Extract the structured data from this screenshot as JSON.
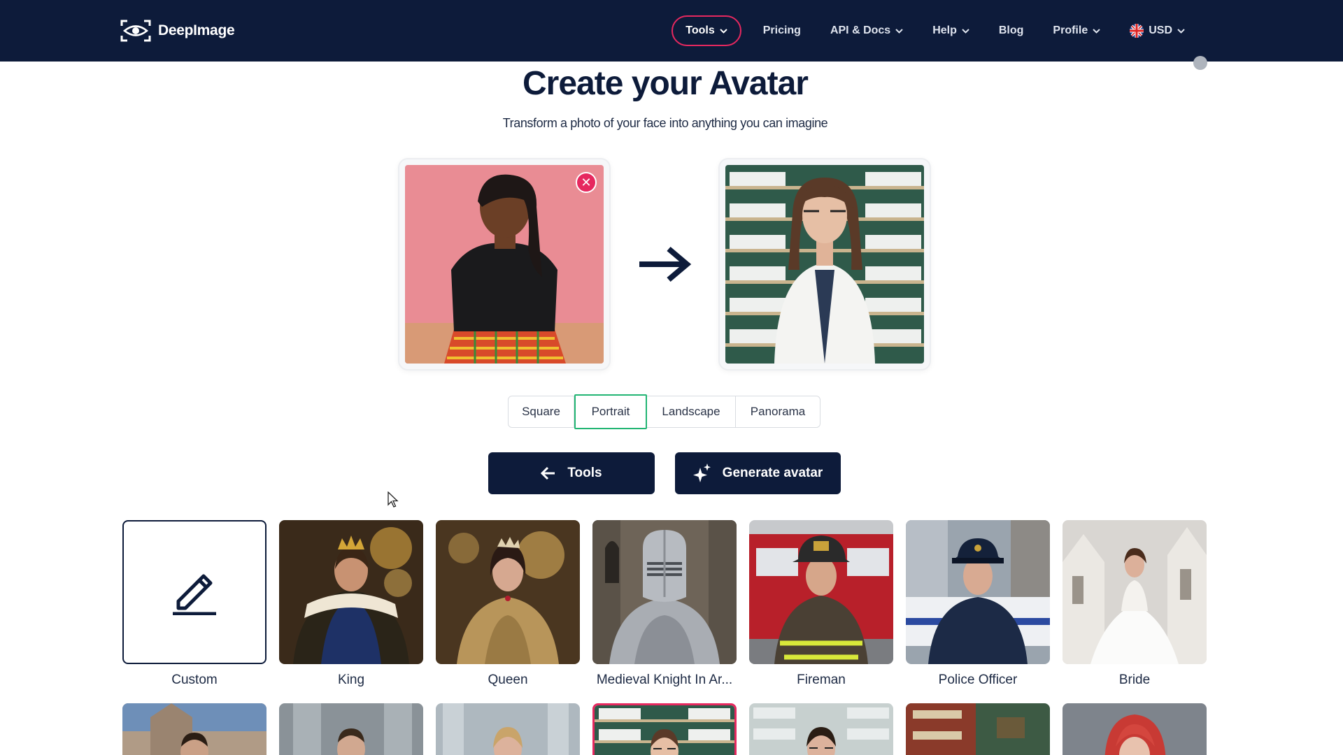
{
  "header": {
    "logo_text": "DeepImage",
    "nav": [
      {
        "label": "Tools",
        "has_dropdown": true,
        "active": true
      },
      {
        "label": "Pricing",
        "has_dropdown": false
      },
      {
        "label": "API & Docs",
        "has_dropdown": true
      },
      {
        "label": "Help",
        "has_dropdown": true
      },
      {
        "label": "Blog",
        "has_dropdown": false
      },
      {
        "label": "Profile",
        "has_dropdown": true
      },
      {
        "label": "USD",
        "has_dropdown": true,
        "icon": "uk-flag-icon"
      }
    ]
  },
  "hero": {
    "title": "Create your Avatar",
    "subtitle": "Transform a photo of your face into anything you can imagine"
  },
  "aspect": {
    "options": [
      "Square",
      "Portrait",
      "Landscape",
      "Panorama"
    ],
    "selected": "Portrait"
  },
  "actions": {
    "back_label": "Tools",
    "generate_label": "Generate avatar"
  },
  "styles": {
    "row1": [
      {
        "label": "Custom"
      },
      {
        "label": "King"
      },
      {
        "label": "Queen"
      },
      {
        "label": "Medieval Knight In Ar..."
      },
      {
        "label": "Fireman"
      },
      {
        "label": "Police Officer"
      },
      {
        "label": "Bride"
      }
    ]
  },
  "colors": {
    "navy": "#0d1b3a",
    "accent_pink": "#e6285f",
    "accent_green": "#22b573"
  }
}
